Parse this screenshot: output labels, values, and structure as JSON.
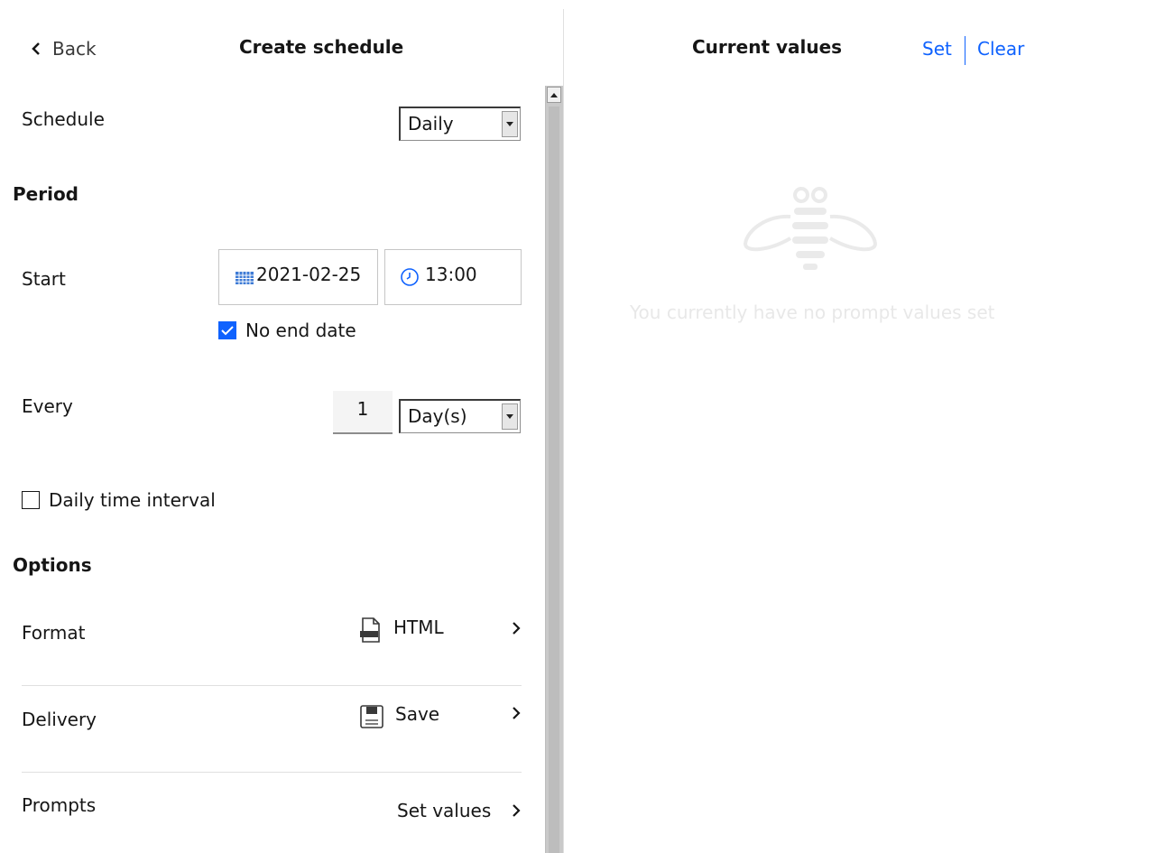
{
  "header": {
    "back_label": "Back",
    "title": "Create schedule"
  },
  "schedule": {
    "label": "Schedule",
    "selected": "Daily"
  },
  "period": {
    "heading": "Period",
    "start_label": "Start",
    "start_date": "2021-02-25",
    "start_time": "13:00",
    "no_end_date_label": "No end date",
    "no_end_date_checked": true
  },
  "every": {
    "label": "Every",
    "value": "1",
    "unit": "Day(s)"
  },
  "daily_interval": {
    "label": "Daily time interval",
    "checked": false
  },
  "options": {
    "heading": "Options",
    "format_label": "Format",
    "format_value": "HTML",
    "delivery_label": "Delivery",
    "delivery_value": "Save",
    "prompts_label": "Prompts",
    "prompts_value": "Set values"
  },
  "current_values": {
    "title": "Current values",
    "set_label": "Set",
    "clear_label": "Clear",
    "empty_message": "You currently have no prompt values set"
  },
  "colors": {
    "accent": "#0f62fe",
    "text": "#161616",
    "divider": "#e0e0e0"
  }
}
